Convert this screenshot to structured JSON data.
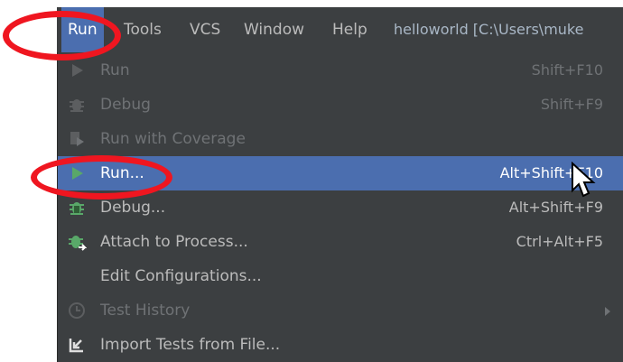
{
  "menubar": {
    "items": [
      {
        "label": "Run",
        "mnemonic": "u",
        "active": true
      },
      {
        "label": "Tools",
        "mnemonic": "T",
        "active": false
      },
      {
        "label": "VCS",
        "mnemonic": "S",
        "active": false
      },
      {
        "label": "Window",
        "mnemonic": "W",
        "active": false
      },
      {
        "label": "Help",
        "mnemonic": "H",
        "active": false
      }
    ],
    "project_title": "helloworld [C:\\Users\\muke"
  },
  "run_menu": {
    "items": [
      {
        "label": "Run",
        "shortcut": "Shift+F10",
        "icon": "play-icon",
        "state": "disabled"
      },
      {
        "label": "Debug",
        "shortcut": "Shift+F9",
        "icon": "bug-icon",
        "state": "disabled"
      },
      {
        "label": "Run with Coverage",
        "shortcut": "",
        "icon": "coverage-icon",
        "state": "disabled"
      },
      {
        "label": "Run...",
        "shortcut": "Alt+Shift+F10",
        "icon": "play-icon",
        "state": "highlighted"
      },
      {
        "label": "Debug...",
        "shortcut": "Alt+Shift+F9",
        "icon": "bug-icon",
        "state": "enabled"
      },
      {
        "label": "Attach to Process...",
        "shortcut": "Ctrl+Alt+F5",
        "icon": "attach-process-icon",
        "state": "enabled"
      },
      {
        "label": "Edit Configurations...",
        "shortcut": "",
        "icon": "",
        "state": "enabled"
      },
      {
        "label": "Test History",
        "shortcut": "",
        "icon": "clock-icon",
        "state": "disabled",
        "submenu": true
      },
      {
        "label": "Import Tests from File...",
        "shortcut": "",
        "icon": "import-tests-icon",
        "state": "enabled"
      }
    ]
  },
  "colors": {
    "menu_background": "#3c3f41",
    "highlight": "#4b6eaf",
    "text": "#bbbbbb",
    "disabled_text": "#6f7275",
    "annotation": "#ef1620",
    "run_icon": "#59a869"
  }
}
